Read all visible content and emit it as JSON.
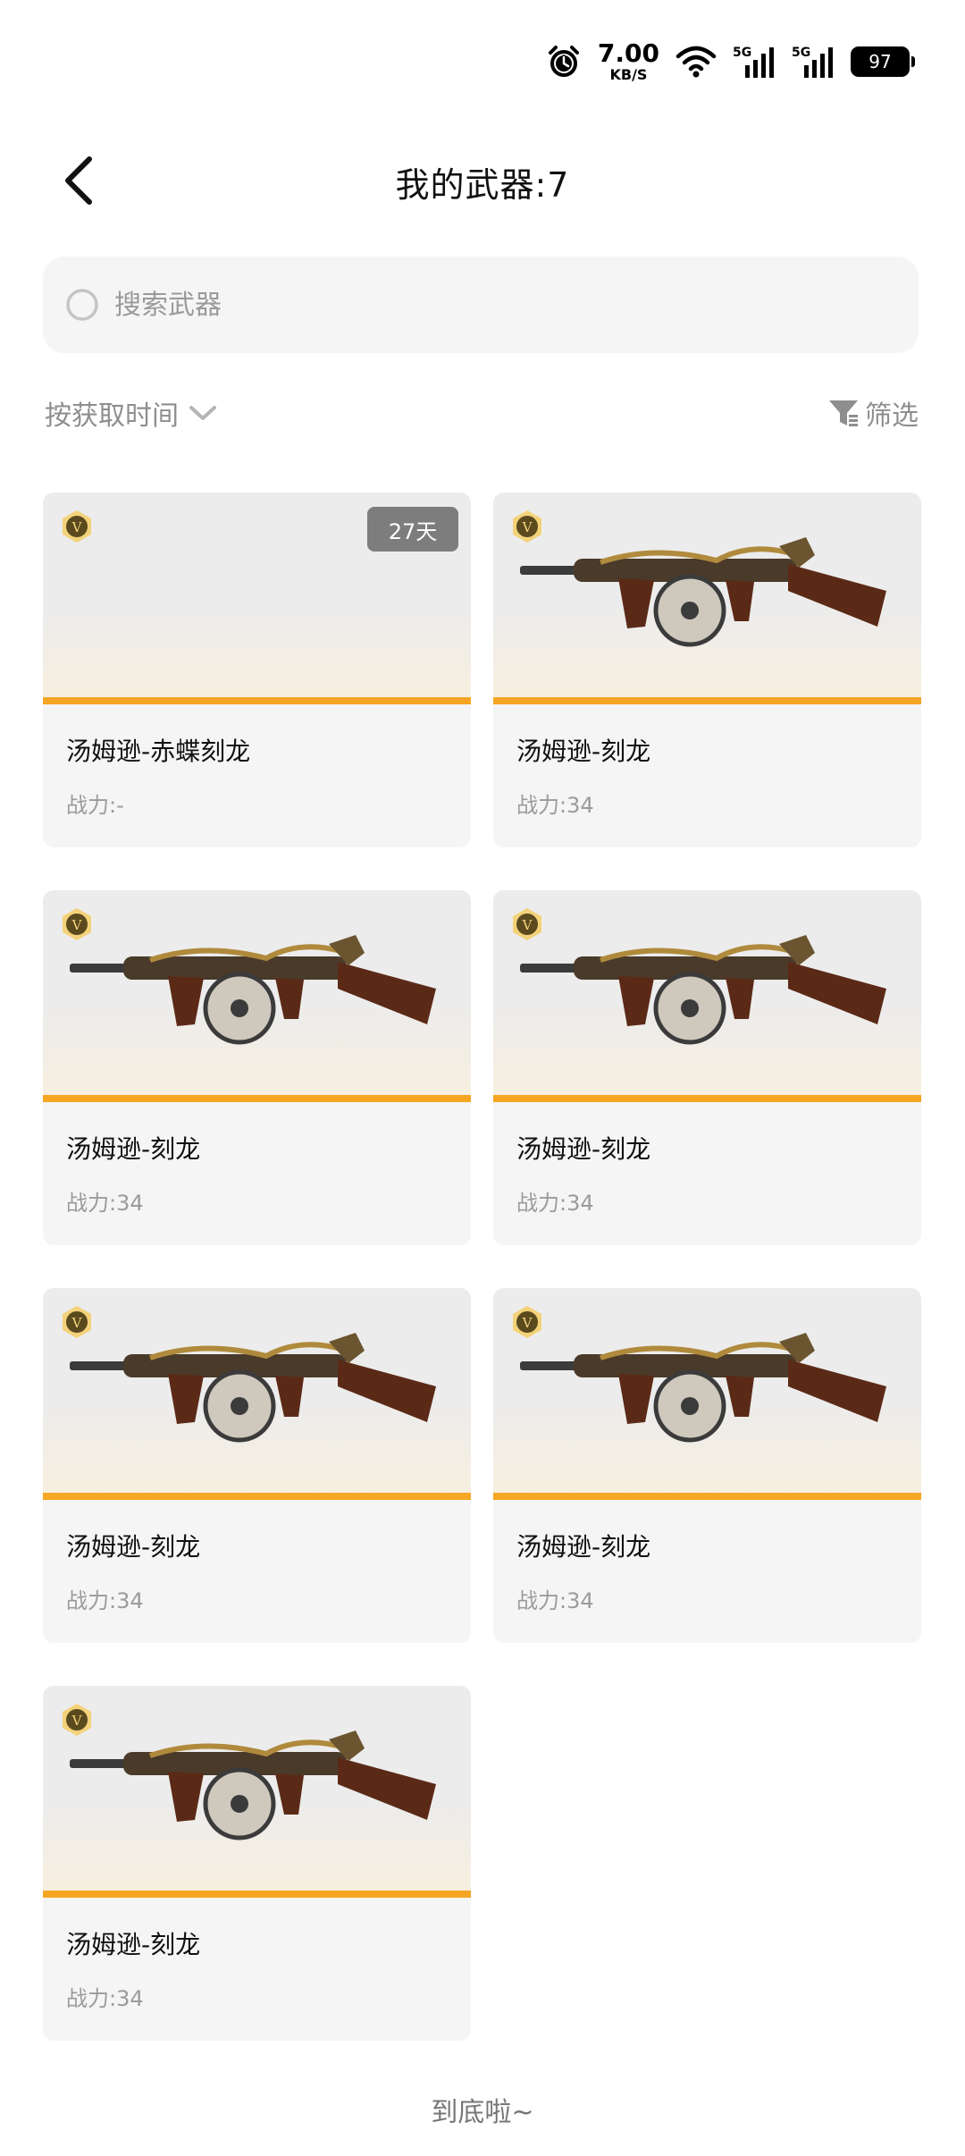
{
  "status_bar": {
    "net_speed_value": "7.00",
    "net_speed_unit": "KB/S",
    "battery_level": "97",
    "icons": [
      "alarm-icon",
      "wifi-icon",
      "signal-5g-icon",
      "signal-5g-icon",
      "battery-icon"
    ]
  },
  "header": {
    "title": "我的武器:7"
  },
  "search": {
    "placeholder": "搜索武器"
  },
  "toolbar": {
    "sort_label": "按获取时间",
    "filter_label": "筛选"
  },
  "weapons": [
    {
      "name": "汤姆逊-赤蝶刻龙",
      "power": "战力:-",
      "tag": "27天",
      "has_image": false
    },
    {
      "name": "汤姆逊-刻龙",
      "power": "战力:34",
      "has_image": true
    },
    {
      "name": "汤姆逊-刻龙",
      "power": "战力:34",
      "has_image": true
    },
    {
      "name": "汤姆逊-刻龙",
      "power": "战力:34",
      "has_image": true
    },
    {
      "name": "汤姆逊-刻龙",
      "power": "战力:34",
      "has_image": true
    },
    {
      "name": "汤姆逊-刻龙",
      "power": "战力:34",
      "has_image": true
    },
    {
      "name": "汤姆逊-刻龙",
      "power": "战力:34",
      "has_image": true
    }
  ],
  "footer": {
    "end_text": "到底啦~"
  },
  "colors": {
    "accent_bar": "#f5a623",
    "card_bg": "#f5f5f5",
    "tag_bg": "#7d7d7d",
    "secondary_text": "#9b9b9b"
  }
}
